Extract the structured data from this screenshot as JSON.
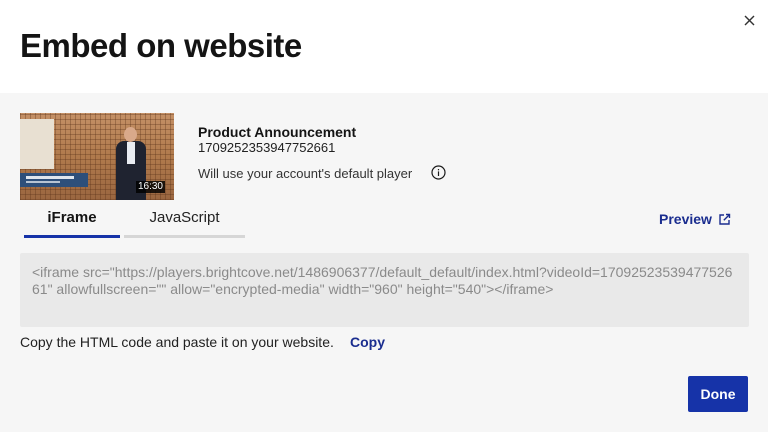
{
  "dialog": {
    "title": "Embed on website",
    "close_icon": "close-icon"
  },
  "video": {
    "name": "Product Announcement",
    "id": "1709252353947752661",
    "duration": "16:30",
    "player_note": "Will use your account's default player",
    "info_icon": "info-icon"
  },
  "tabs": [
    {
      "label": "iFrame",
      "active": true
    },
    {
      "label": "JavaScript",
      "active": false
    }
  ],
  "preview": {
    "label": "Preview",
    "icon": "external-link-icon"
  },
  "embed_code": "<iframe src=\"https://players.brightcove.net/1486906377/default_default/index.html?videoId=1709252353947752661\" allowfullscreen=\"\" allow=\"encrypted-media\" width=\"960\" height=\"540\"></iframe>",
  "instruction": "Copy the HTML code and paste it on your website.",
  "copy_label": "Copy",
  "done_label": "Done",
  "colors": {
    "accent": "#1633a8",
    "link": "#1a2d8f",
    "body_bg": "#f6f6f6",
    "code_bg": "#e9e9e9"
  }
}
